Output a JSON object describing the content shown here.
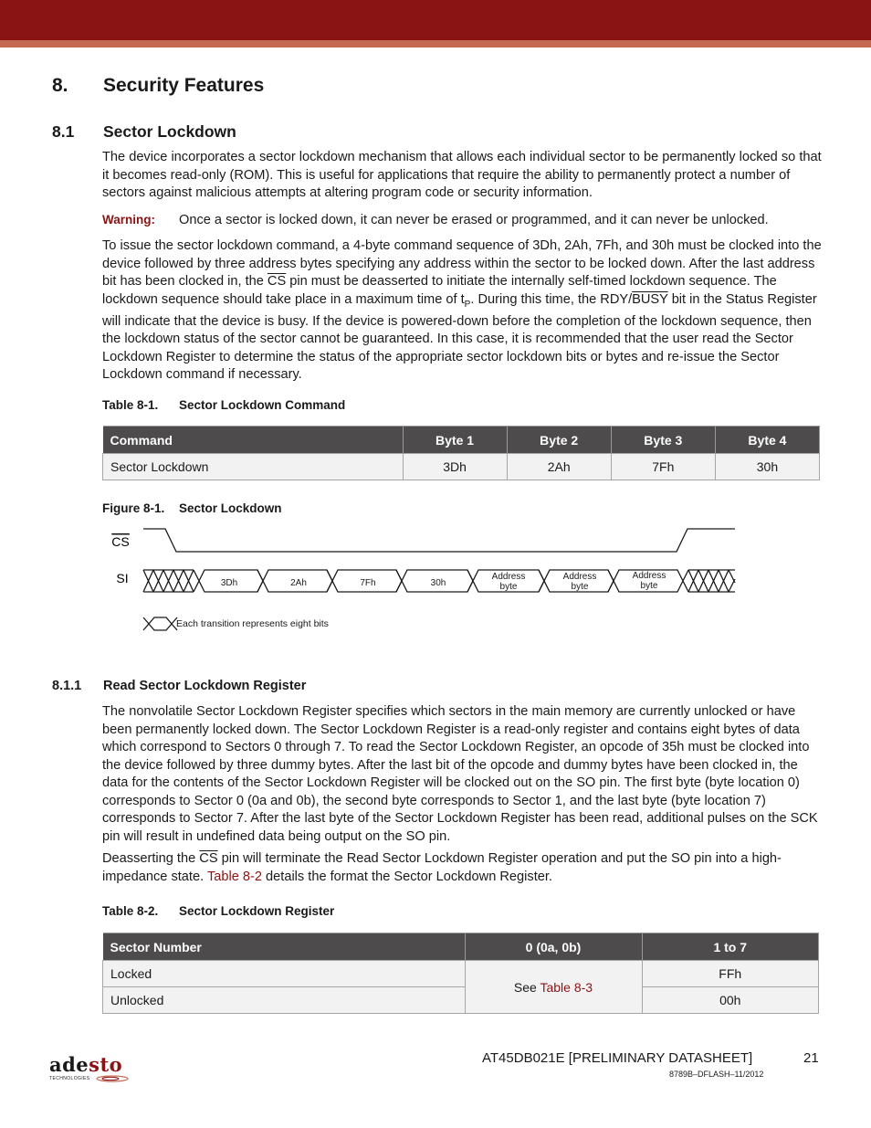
{
  "header": {
    "bar_color": "#8a1314",
    "stripe_color": "#c46a53"
  },
  "section": {
    "number": "8.",
    "title": "Security Features"
  },
  "subsection": {
    "number": "8.1",
    "title": "Sector Lockdown"
  },
  "intro": "The device incorporates a sector lockdown mechanism that allows each individual sector to be permanently locked so that it becomes read-only (ROM). This is useful for applications that require the ability to permanently protect a number of sectors against malicious attempts at altering program code or security information.",
  "warning": {
    "label": "Warning:",
    "text": "Once a sector is locked down, it can never be erased or programmed, and it can never be unlocked."
  },
  "issue_para": {
    "p1": "To issue the sector lockdown command, a 4-byte command sequence of 3Dh, 2Ah, 7Fh, and 30h must be clocked into the device followed by three address bytes specifying any address within the sector to be locked down. After the last address bit has been clocked in, the ",
    "cs": "CS",
    "p2": " pin must be deasserted to initiate the internally self-timed lockdown sequence. The lockdown sequence should take place in a maximum time of t",
    "sub": "P",
    "p3": ". During this time, the RDY/",
    "busy": "BUSY",
    "p4": " bit in the Status Register will indicate that the device is busy. If the device is powered-down before the completion of the lockdown sequence, then the lockdown status of the sector cannot be guaranteed. In this case, it is recommended that the user read the Sector Lockdown Register to determine the status of the appropriate sector lockdown bits or bytes and re-issue the Sector Lockdown command if necessary."
  },
  "table1": {
    "caption_num": "Table 8-1.",
    "caption": "Sector Lockdown Command",
    "headers": [
      "Command",
      "Byte 1",
      "Byte 2",
      "Byte 3",
      "Byte 4"
    ],
    "rows": [
      [
        "Sector Lockdown",
        "3Dh",
        "2Ah",
        "7Fh",
        "30h"
      ]
    ]
  },
  "figure1": {
    "caption_num": "Figure 8-1.",
    "caption": "Sector Lockdown",
    "cs_label": "CS",
    "si_label": "SI",
    "bytes": [
      "3Dh",
      "2Ah",
      "7Fh",
      "30h"
    ],
    "address_line1": "Address",
    "address_line2": "byte",
    "legend": "Each transition represents eight bits"
  },
  "subsubsection": {
    "number": "8.1.1",
    "title": "Read Sector Lockdown Register"
  },
  "read_para": "The nonvolatile Sector Lockdown Register specifies which sectors in the main memory are currently unlocked or have been permanently locked down. The Sector Lockdown Register is a read-only register and contains eight bytes of data which correspond to Sectors 0 through 7. To read the Sector Lockdown Register, an opcode of 35h must be clocked into the device followed by three dummy bytes. After the last bit of the opcode and dummy bytes have been clocked in, the data for the contents of the Sector Lockdown Register will be clocked out on the SO pin. The first byte (byte location 0) corresponds to Sector 0 (0a and 0b), the second byte corresponds to Sector 1, and the last byte (byte location 7) corresponds to Sector 7. After the last byte of the Sector Lockdown Register has been read, additional pulses on the SCK pin will result in undefined data being output on the SO pin.",
  "deassert_para": {
    "p1": "Deasserting the ",
    "cs": "CS",
    "p2": " pin will terminate the Read Sector Lockdown Register operation and put the SO pin into a high-impedance state. ",
    "link": "Table 8-2",
    "p3": " details the format the Sector Lockdown Register."
  },
  "table2": {
    "caption_num": "Table 8-2.",
    "caption": "Sector Lockdown Register",
    "headers": [
      "Sector Number",
      "0 (0a, 0b)",
      "1 to 7"
    ],
    "rows": [
      {
        "label": "Locked",
        "value": "FFh"
      },
      {
        "label": "Unlocked",
        "value": "00h"
      }
    ],
    "merged_prefix": "See ",
    "merged_link": "Table 8-3"
  },
  "footer": {
    "logo_part1": "ade",
    "logo_part2": "sto",
    "logo_sub": "TECHNOLOGIES",
    "title": "AT45DB021E [PRELIMINARY DATASHEET]",
    "page": "21",
    "doc_code": "8789B–DFLASH–11/2012"
  }
}
